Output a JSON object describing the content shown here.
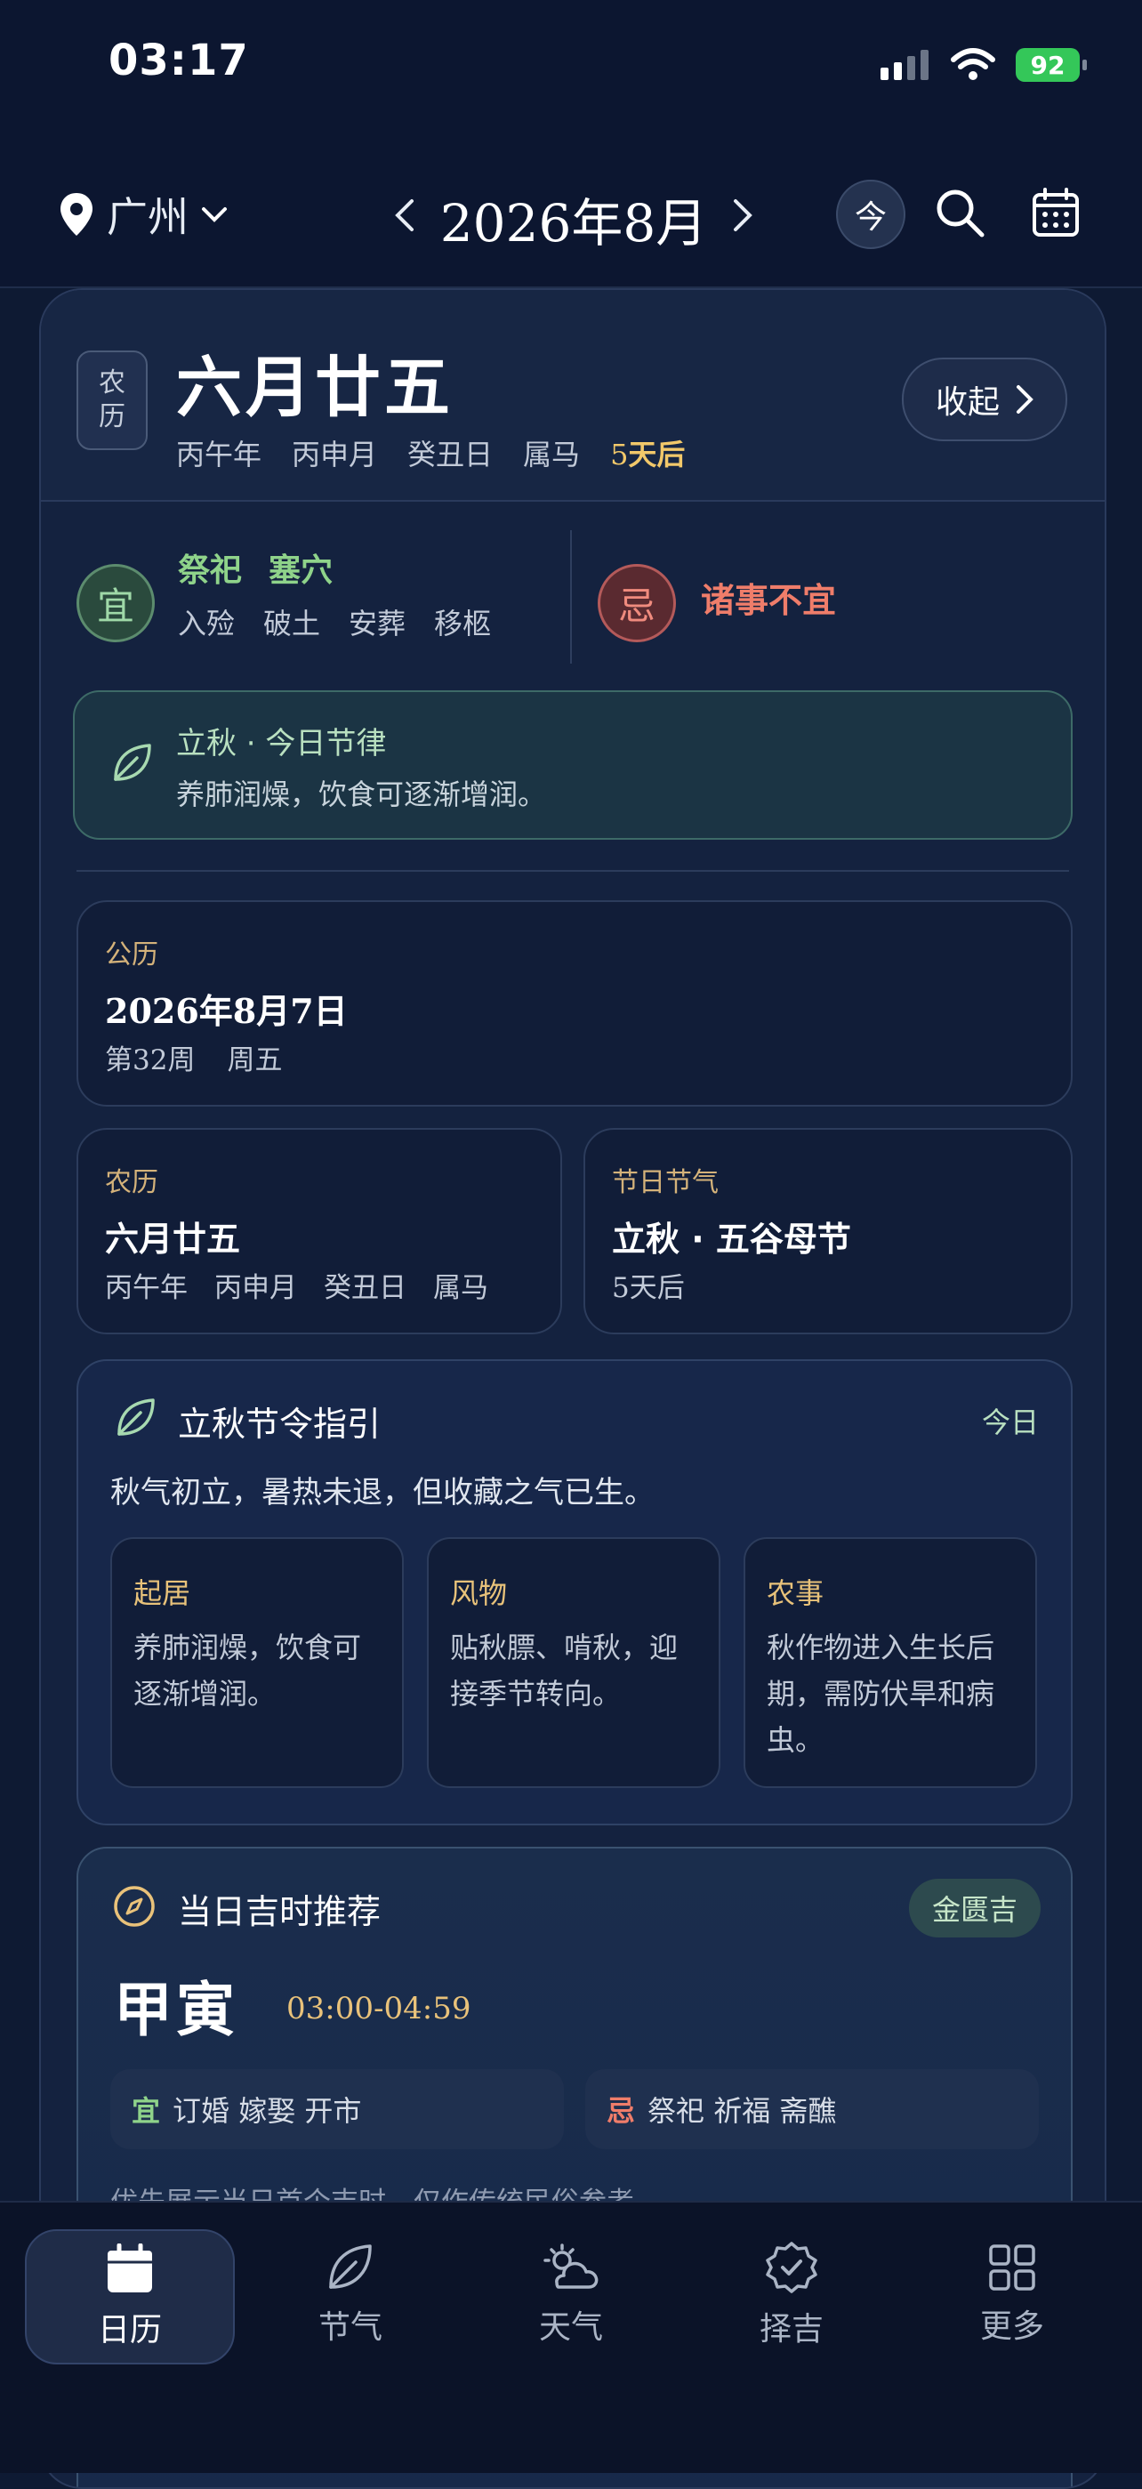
{
  "status_bar": {
    "time": "03:17",
    "battery": "92"
  },
  "header": {
    "city": "广州",
    "month_title": "2026年8月",
    "today_label": "今"
  },
  "day_header": {
    "badge": [
      "农",
      "历"
    ],
    "lunar_date": "六月廿五",
    "ganzhi": [
      "丙午年",
      "丙申月",
      "癸丑日",
      "属马"
    ],
    "countdown_num": "5",
    "countdown_text": "天后",
    "collapse_label": "收起"
  },
  "yi": {
    "label": "宜",
    "main": [
      "祭祀",
      "塞穴"
    ],
    "sub": [
      "入殓",
      "破土",
      "安葬",
      "移柩"
    ]
  },
  "ji": {
    "label": "忌",
    "main": "诸事不宜"
  },
  "jielv": {
    "title": "立秋 · 今日节律",
    "text": "养肺润燥，饮食可逐渐增润。"
  },
  "gongli": {
    "label": "公历",
    "value": "2026年8月7日",
    "sub": [
      "第32周",
      "周五"
    ]
  },
  "nongli": {
    "label": "农历",
    "value": "六月廿五",
    "sub": [
      "丙午年",
      "丙申月",
      "癸丑日",
      "属马"
    ]
  },
  "jieqi": {
    "label": "节日节气",
    "value": "立秋 · 五谷母节",
    "sub": "5天后"
  },
  "guide": {
    "title": "立秋节令指引",
    "today": "今日",
    "desc": "秋气初立，暑热未退，但收藏之气已生。",
    "items": [
      {
        "title": "起居",
        "text": "养肺润燥，饮食可逐渐增润。"
      },
      {
        "title": "风物",
        "text": "贴秋膘、啃秋，迎接季节转向。"
      },
      {
        "title": "农事",
        "text": "秋作物进入生长后期，需防伏旱和病虫。"
      }
    ]
  },
  "jishi": {
    "title": "当日吉时推荐",
    "badge": "金匮吉",
    "ganzhi": "甲寅",
    "time": "03:00-04:59",
    "yi_label": "宜",
    "yi_items": "订婚 嫁娶 开市",
    "ji_label": "忌",
    "ji_items": "祭祀 祈福 斋醮",
    "note": "优先展示当日首个吉时，仅作传统民俗参考。"
  },
  "tabs": [
    {
      "label": "日历",
      "icon": "calendar-icon"
    },
    {
      "label": "节气",
      "icon": "leaf-icon"
    },
    {
      "label": "天气",
      "icon": "weather-icon"
    },
    {
      "label": "择吉",
      "icon": "badge-check-icon"
    },
    {
      "label": "更多",
      "icon": "grid-icon"
    }
  ],
  "colors": {
    "accent_green": "#8fd38a",
    "accent_red": "#ef7d6a",
    "accent_gold": "#e9c27a",
    "bg": "#0e1a33"
  }
}
